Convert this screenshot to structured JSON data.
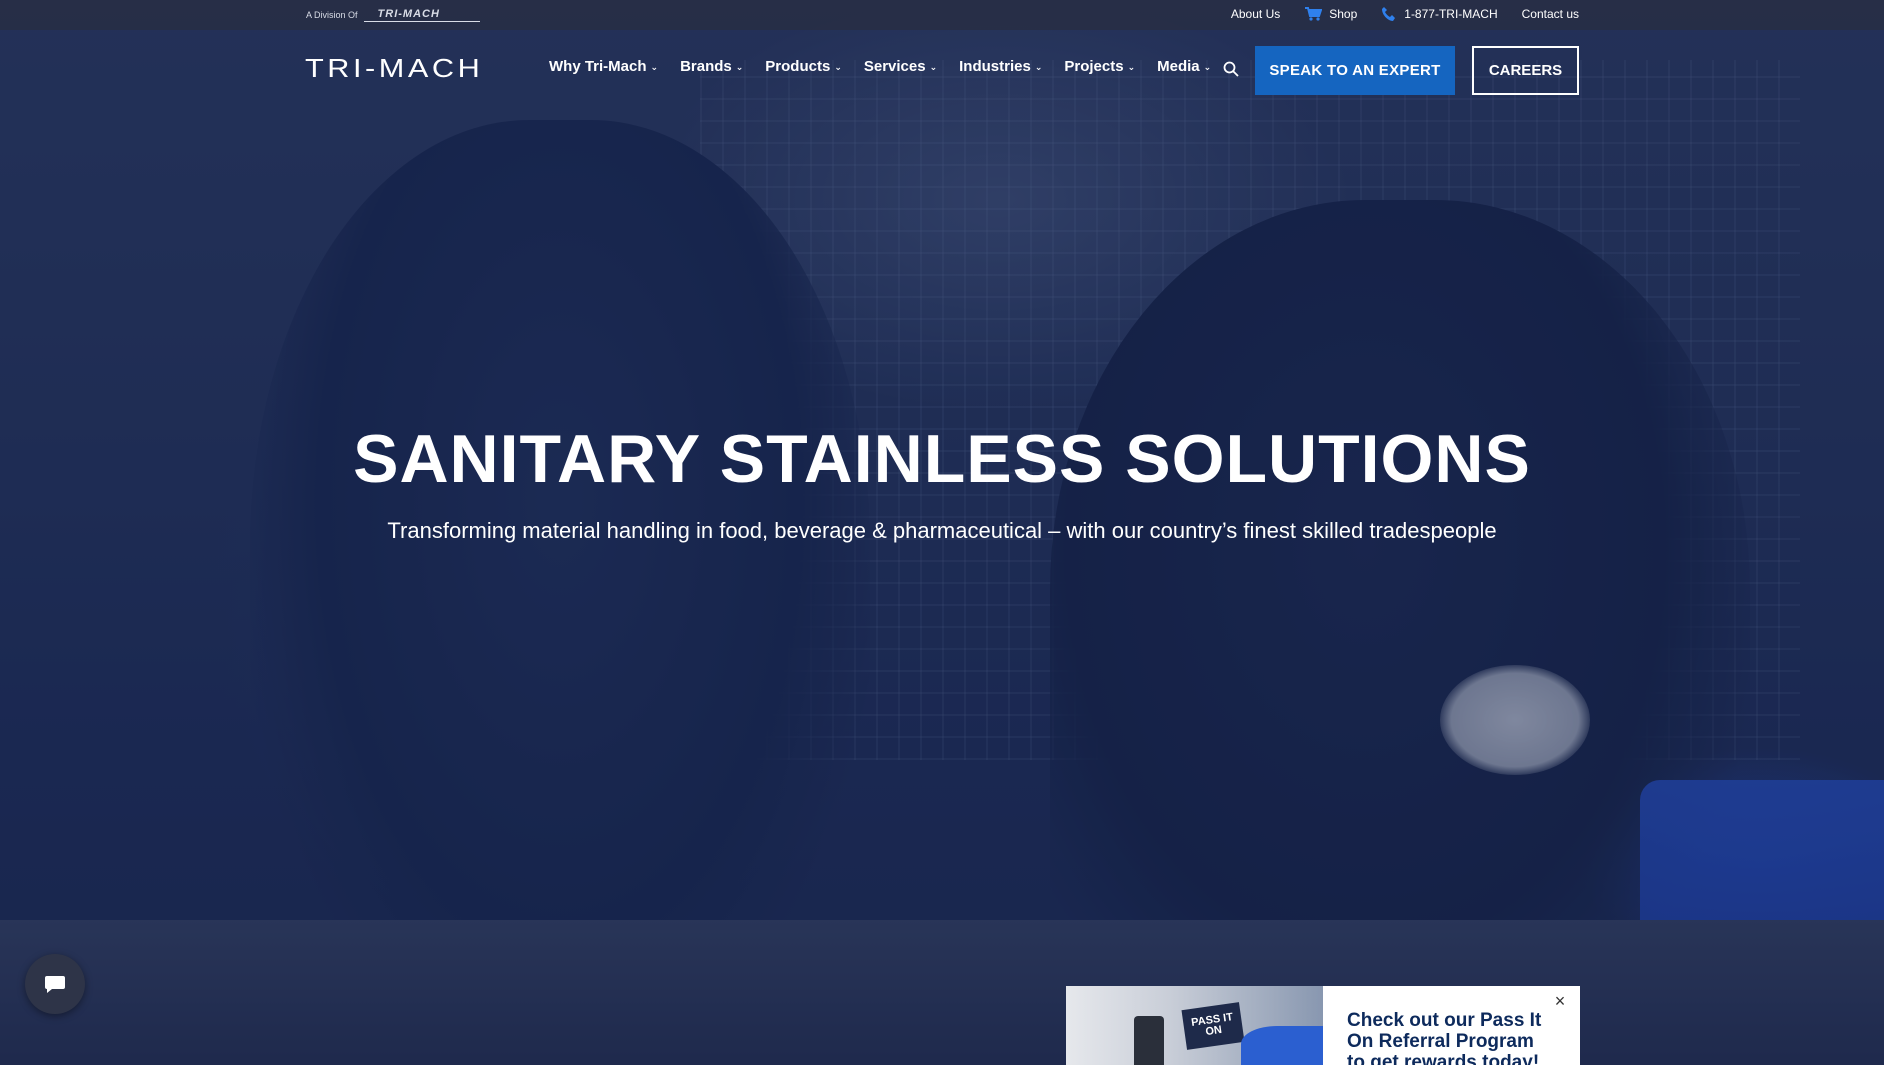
{
  "utility": {
    "division_prefix": "A Division Of",
    "division_logo": "TRI-MACH",
    "about": "About Us",
    "shop": "Shop",
    "phone": "1-877-TRI-MACH",
    "contact": "Contact us"
  },
  "brand": {
    "logo_text": "TRI-MACH"
  },
  "nav": {
    "items": [
      {
        "label": "Why Tri-Mach"
      },
      {
        "label": "Brands"
      },
      {
        "label": "Products"
      },
      {
        "label": "Services"
      },
      {
        "label": "Industries"
      },
      {
        "label": "Projects"
      },
      {
        "label": "Media"
      }
    ],
    "expert_button": "SPEAK TO AN EXPERT",
    "careers_button": "CAREERS"
  },
  "hero": {
    "title": "SANITARY STAINLESS SOLUTIONS",
    "subtitle": "Transforming material handling in food, beverage & pharmaceutical – with our country’s finest skilled tradespeople"
  },
  "promo": {
    "sign_text": "PASS IT ON",
    "text": "Check out our Pass It On Referral Program to get rewards today!",
    "close": "×"
  },
  "colors": {
    "accent": "#1565c0",
    "promo_text": "#0d2a5c"
  },
  "icons": {
    "search": "search-icon",
    "cart": "cart-icon",
    "phone": "phone-icon",
    "chat": "chat-icon",
    "close": "close-icon"
  }
}
